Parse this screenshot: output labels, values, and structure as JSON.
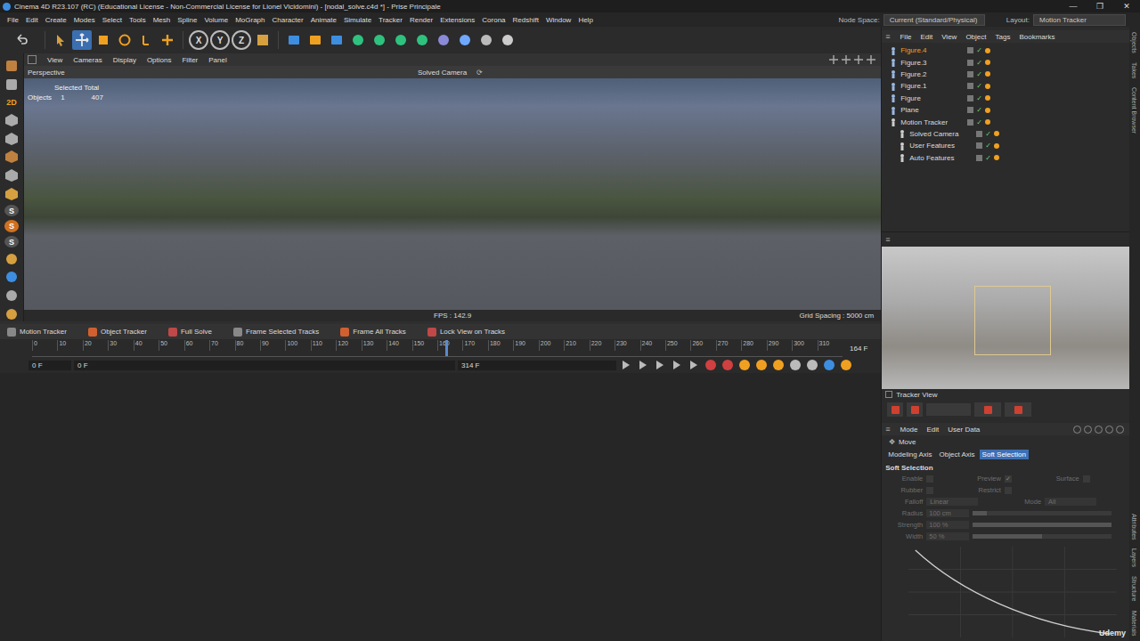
{
  "window": {
    "title": "Cinema 4D R23.107 (RC) (Educational License - Non-Commercial License for Lionel Vicidomini) - [nodal_solve.c4d *] - Prise Principale",
    "controls": [
      "—",
      "❐",
      "✕"
    ]
  },
  "menu": [
    "File",
    "Edit",
    "Create",
    "Modes",
    "Select",
    "Tools",
    "Mesh",
    "Spline",
    "Volume",
    "MoGraph",
    "Character",
    "Animate",
    "Simulate",
    "Tracker",
    "Render",
    "Extensions",
    "Corona",
    "Redshift",
    "Window",
    "Help"
  ],
  "node_space": {
    "label": "Node Space:",
    "value": "Current (Standard/Physical)"
  },
  "layout": {
    "label": "Layout:",
    "value": "Motion Tracker"
  },
  "tools": [
    {
      "kind": "select",
      "selected": false
    },
    {
      "kind": "move",
      "selected": true
    },
    {
      "kind": "scale",
      "selected": false
    },
    {
      "kind": "rotate",
      "selected": false
    },
    {
      "kind": "recent",
      "selected": false
    },
    {
      "kind": "add",
      "selected": false
    }
  ],
  "axis_buttons": [
    "X",
    "Y",
    "Z"
  ],
  "palette_labels": {
    "mode": "2D",
    "snaps": [
      "S",
      "S",
      "S"
    ]
  },
  "viewport": {
    "menu": [
      "View",
      "Cameras",
      "Display",
      "Options",
      "Filter",
      "Panel"
    ],
    "name": "Perspective",
    "camera": "Solved Camera",
    "hud": {
      "title": "Selected Total",
      "label": "Objects",
      "selected": "1",
      "total": "407"
    },
    "fps": "FPS : 142.9",
    "grid": "Grid Spacing : 5000 cm"
  },
  "tracker_bar": [
    {
      "label": "Motion Tracker",
      "disabled": false
    },
    {
      "label": "Object Tracker",
      "disabled": false
    },
    {
      "label": "Full Solve",
      "disabled": false
    },
    {
      "label": "Frame Selected Tracks",
      "disabled": false
    },
    {
      "label": "Frame All Tracks",
      "disabled": false
    },
    {
      "label": "Lock View on Tracks",
      "disabled": false
    }
  ],
  "timeline": {
    "ticks": [
      "0",
      "10",
      "20",
      "30",
      "40",
      "50",
      "60",
      "70",
      "80",
      "90",
      "100",
      "110",
      "120",
      "130",
      "140",
      "150",
      "160",
      "170",
      "180",
      "190",
      "200",
      "210",
      "220",
      "230",
      "240",
      "250",
      "260",
      "270",
      "280",
      "290",
      "300",
      "310"
    ],
    "current": "164 F",
    "level": 0.51
  },
  "transport": {
    "start": "0 F",
    "field": "0 F",
    "end": "314 F"
  },
  "objects": {
    "menu": [
      "File",
      "Edit",
      "View",
      "Object",
      "Tags",
      "Bookmarks"
    ],
    "items": [
      {
        "name": "Figure.4",
        "child": false,
        "selected": true,
        "kind": "figure"
      },
      {
        "name": "Figure.3",
        "child": false,
        "selected": false,
        "kind": "figure"
      },
      {
        "name": "Figure.2",
        "child": false,
        "selected": false,
        "kind": "figure"
      },
      {
        "name": "Figure.1",
        "child": false,
        "selected": false,
        "kind": "figure"
      },
      {
        "name": "Figure",
        "child": false,
        "selected": false,
        "kind": "figure"
      },
      {
        "name": "Plane",
        "child": false,
        "selected": false,
        "kind": "plane"
      },
      {
        "name": "Motion Tracker",
        "child": false,
        "selected": false,
        "kind": "tracker"
      },
      {
        "name": "Solved Camera",
        "child": true,
        "selected": false,
        "kind": "camera"
      },
      {
        "name": "User Features",
        "child": true,
        "selected": false,
        "kind": "features"
      },
      {
        "name": "Auto Features",
        "child": true,
        "selected": false,
        "kind": "features"
      }
    ]
  },
  "tracker_view": {
    "label": "Tracker View"
  },
  "attributes": {
    "menu": [
      "Mode",
      "Edit",
      "User Data"
    ],
    "title": "Move",
    "tabs": [
      {
        "label": "Modeling Axis",
        "selected": false
      },
      {
        "label": "Object Axis",
        "selected": false
      },
      {
        "label": "Soft Selection",
        "selected": true
      }
    ],
    "section": "Soft Selection",
    "disabled": true,
    "fields": [
      {
        "kind": "check",
        "label": "Enable",
        "checked": false
      },
      {
        "kind": "check",
        "label": "Preview",
        "checked": true
      },
      {
        "kind": "check",
        "label": "Surface",
        "checked": false
      },
      {
        "kind": "check",
        "label": "Rubber",
        "checked": false
      },
      {
        "kind": "check",
        "label": "Restrict",
        "checked": false
      },
      {
        "kind": "select",
        "label": "Falloff",
        "value": "Linear"
      },
      {
        "kind": "select",
        "label": "Mode",
        "value": "All"
      },
      {
        "kind": "slider",
        "label": "Radius",
        "value": "100 cm",
        "level": 0.1
      },
      {
        "kind": "slider",
        "label": "Strength",
        "value": "100 %",
        "level": 1
      },
      {
        "kind": "slider",
        "label": "Width",
        "value": "50 %",
        "level": 0.5
      }
    ]
  },
  "side_tabs": {
    "top": [
      "Objects",
      "Takes",
      "Content Browser"
    ],
    "bottom": [
      "Attributes",
      "Layers",
      "Structure",
      "Materials"
    ]
  },
  "brand": "Udemy"
}
